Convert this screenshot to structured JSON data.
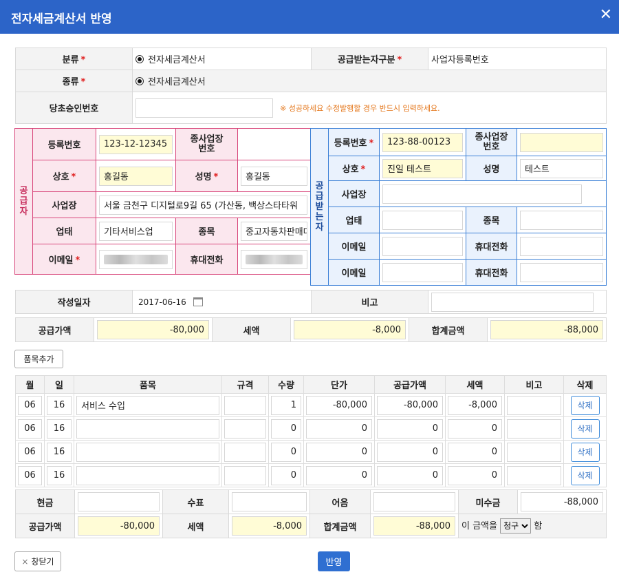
{
  "dialog": {
    "title": "전자세금계산서 반영",
    "close_icon": "✕"
  },
  "top": {
    "category_label": "분류",
    "category_value": "전자세금계산서",
    "receiver_type_label": "공급받는자구분",
    "receiver_type_value": "사업자등록번호",
    "kind_label": "종류",
    "kind_value": "전자세금계산서",
    "orig_approval_label": "당초승인번호",
    "orig_approval_value": "",
    "orig_approval_note": "※ 성공하세요 수정발행할 경우 반드시 입력하세요.",
    "required_mark": "*"
  },
  "supplier": {
    "side_label": "공급자",
    "reg_no_label": "등록번호",
    "reg_no": "123-12-12345",
    "sub_biz_label": "종사업장\n번호",
    "sub_biz": "",
    "company_label": "상호",
    "company": "홍길동",
    "name_label": "성명",
    "name": "홍길동",
    "address_label": "사업장",
    "address": "서울 금천구 디지털로9길 65 (가산동, 백상스타타워",
    "biz_type_label": "업태",
    "biz_type": "기타서비스업",
    "biz_item_label": "종목",
    "biz_item": "중고자동차판매대행",
    "email_label": "이메일",
    "phone_label": "휴대전화"
  },
  "buyer": {
    "side_label": "공급받는자",
    "reg_no_label": "등록번호",
    "reg_no": "123-88-00123",
    "sub_biz_label": "종사업장\n번호",
    "sub_biz": "",
    "company_label": "상호",
    "company": "진일 테스트",
    "name_label": "성명",
    "name": "테스트",
    "address_label": "사업장",
    "address": "",
    "biz_type_label": "업태",
    "biz_type": "",
    "biz_item_label": "종목",
    "biz_item": "",
    "email_label": "이메일",
    "phone_label": "휴대전화",
    "email2_label": "이메일",
    "phone2_label": "휴대전화"
  },
  "date_row": {
    "date_label": "작성일자",
    "date_value": "2017-06-16",
    "memo_label": "비고",
    "memo_value": ""
  },
  "totals": {
    "supply_label": "공급가액",
    "supply": "-80,000",
    "tax_label": "세액",
    "tax": "-8,000",
    "total_label": "합계금액",
    "total": "-88,000"
  },
  "add_item_button": "품목추가",
  "items": {
    "headers": [
      "월",
      "일",
      "품목",
      "규격",
      "수량",
      "단가",
      "공급가액",
      "세액",
      "비고",
      "삭제"
    ],
    "delete_label": "삭제",
    "rows": [
      {
        "month": "06",
        "day": "16",
        "name": "서비스 수입",
        "spec": "",
        "qty": "1",
        "price": "-80,000",
        "supply": "-80,000",
        "tax": "-8,000",
        "memo": ""
      },
      {
        "month": "06",
        "day": "16",
        "name": "",
        "spec": "",
        "qty": "0",
        "price": "0",
        "supply": "0",
        "tax": "0",
        "memo": ""
      },
      {
        "month": "06",
        "day": "16",
        "name": "",
        "spec": "",
        "qty": "0",
        "price": "0",
        "supply": "0",
        "tax": "0",
        "memo": ""
      },
      {
        "month": "06",
        "day": "16",
        "name": "",
        "spec": "",
        "qty": "0",
        "price": "0",
        "supply": "0",
        "tax": "0",
        "memo": ""
      }
    ]
  },
  "payment": {
    "cash_label": "현금",
    "cash": "",
    "check_label": "수표",
    "check": "",
    "note_label": "어음",
    "note": "",
    "credit_label": "미수금",
    "credit": "-88,000",
    "supply_label": "공급가액",
    "supply": "-80,000",
    "tax_label": "세액",
    "tax": "-8,000",
    "total_label": "합계금액",
    "total": "-88,000",
    "claim_prefix": "이 금액을",
    "claim_value": "청구",
    "claim_suffix": "함"
  },
  "footer": {
    "close_label": "창닫기",
    "close_icon": "×",
    "apply_label": "반영"
  },
  "colors": {
    "title_bar": "#2c64c8",
    "supplier_border": "#d8457a",
    "supplier_label_bg": "#fbe7ee",
    "buyer_border": "#3a7fd6",
    "buyer_label_bg": "#eaf2fd",
    "highlight_input": "#fffcd6",
    "apply_button": "#2f6fd1",
    "note_text": "#e4761a",
    "required": "#e02020"
  }
}
